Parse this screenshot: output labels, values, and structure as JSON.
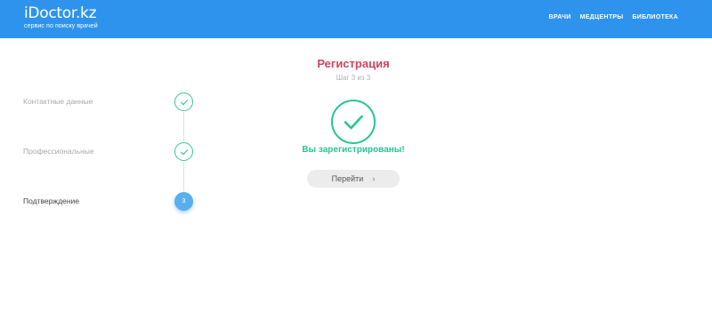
{
  "header": {
    "logo_text": "iDoctor.kz",
    "logo_tagline": "сервис по поиску врачей",
    "nav": [
      "Врачи",
      "Медцентры",
      "Библиотека"
    ]
  },
  "page": {
    "title": "Регистрация",
    "subtitle": "Шаг 3 из 3"
  },
  "steps": [
    {
      "label": "Контактные данные",
      "state": "done"
    },
    {
      "label": "Профессиональные",
      "state": "done"
    },
    {
      "label": "Подтверждение",
      "state": "current",
      "number": "3"
    }
  ],
  "result": {
    "message": "Вы зарегистрированы!",
    "button_label": "Перейти",
    "button_arrow": "›"
  },
  "colors": {
    "header_bg": "#2e93ec",
    "title": "#d2445c",
    "success": "#27c396",
    "current_step": "#5aaeee"
  },
  "icons": [
    "check-icon",
    "chevron-right-icon"
  ]
}
